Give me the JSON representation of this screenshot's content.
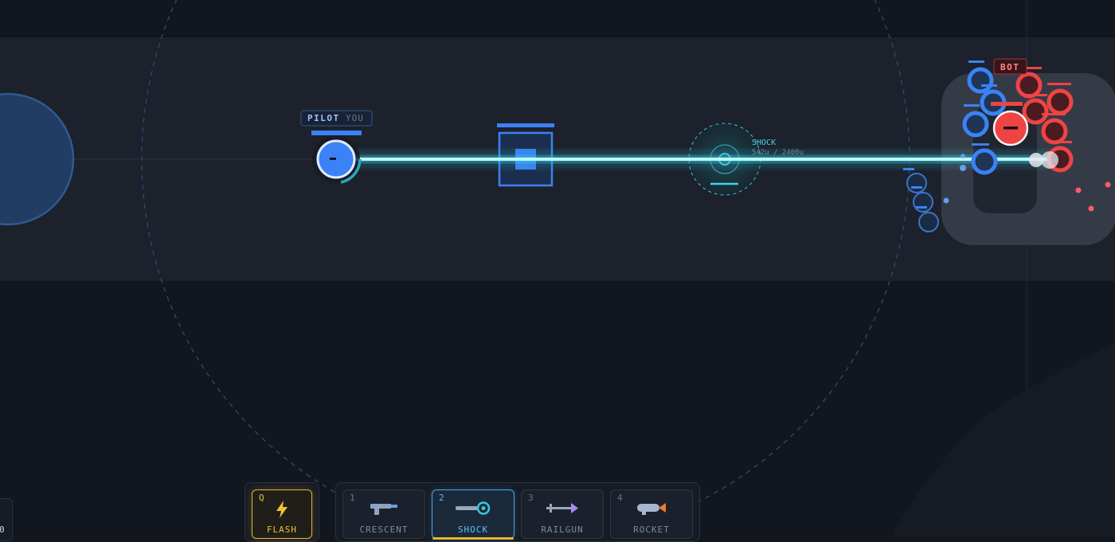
{
  "player": {
    "tag_name": "PILOT",
    "tag_you": "YOU"
  },
  "enemy": {
    "tag": "BOT"
  },
  "reticle": {
    "weapon": "SHOCK",
    "range": "542u / 2400u"
  },
  "ability": {
    "key": "Q",
    "label": "FLASH",
    "icon": "lightning-bolt-icon"
  },
  "weapons": [
    {
      "key": "1",
      "label": "CRESCENT",
      "icon": "pistol-icon",
      "selected": false
    },
    {
      "key": "2",
      "label": "SHOCK",
      "icon": "shock-gun-icon",
      "selected": true
    },
    {
      "key": "3",
      "label": "RAILGUN",
      "icon": "railgun-icon",
      "selected": false
    },
    {
      "key": "4",
      "label": "ROCKET",
      "icon": "rocket-icon",
      "selected": false
    }
  ],
  "corner": {
    "value": "0"
  },
  "colors": {
    "team_blue": "#3b82f6",
    "team_red": "#ef4444",
    "beam": "#5ff0ff",
    "highlight": "#e7b52c",
    "accent": "#49a9e8"
  }
}
